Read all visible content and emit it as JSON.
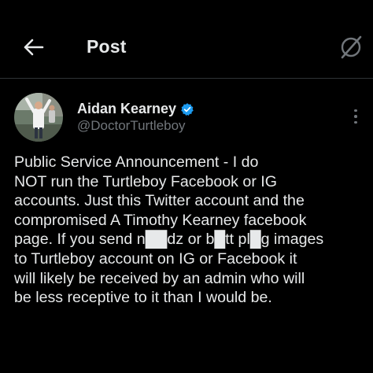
{
  "header": {
    "title": "Post",
    "back_icon": "back-arrow-icon",
    "grok_icon": "grok-icon"
  },
  "author": {
    "display_name": "Aidan Kearney",
    "handle": "@DoctorTurtleboy",
    "verified": true,
    "verified_color": "#1d9bf0",
    "more_icon": "more-vertical-icon"
  },
  "tweet": {
    "text": "Public Service Announcement - I do\nNOT run the Turtleboy Facebook or IG\naccounts. Just this Twitter account and the\ncompromised A Timothy Kearney facebook\npage. If you send n██dz or b█tt pl█g images\nto Turtleboy account on IG or Facebook it\nwill likely be received by an admin who will\nbe less receptive to it than I would be."
  },
  "colors": {
    "background": "#000000",
    "text_primary": "#e7e9ea",
    "text_secondary": "#71767b",
    "divider": "#2f3336"
  }
}
